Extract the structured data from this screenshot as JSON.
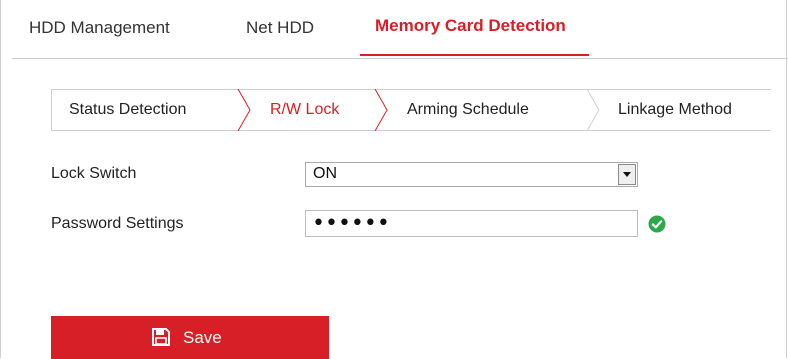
{
  "top_tabs": {
    "hdd_management": "HDD Management",
    "net_hdd": "Net HDD",
    "memory_card_detection": "Memory Card Detection"
  },
  "sub_tabs": {
    "status_detection": "Status Detection",
    "rw_lock": "R/W Lock",
    "arming_schedule": "Arming Schedule",
    "linkage_method": "Linkage Method"
  },
  "form": {
    "lock_switch_label": "Lock Switch",
    "lock_switch_value": "ON",
    "password_label": "Password Settings",
    "password_value": "••••••",
    "password_status_icon": "check-circle-icon"
  },
  "actions": {
    "save_label": "Save",
    "save_icon": "floppy-disk-icon"
  },
  "colors": {
    "accent": "#d61f26",
    "success": "#2aa84a",
    "border": "#cfcfcf"
  }
}
